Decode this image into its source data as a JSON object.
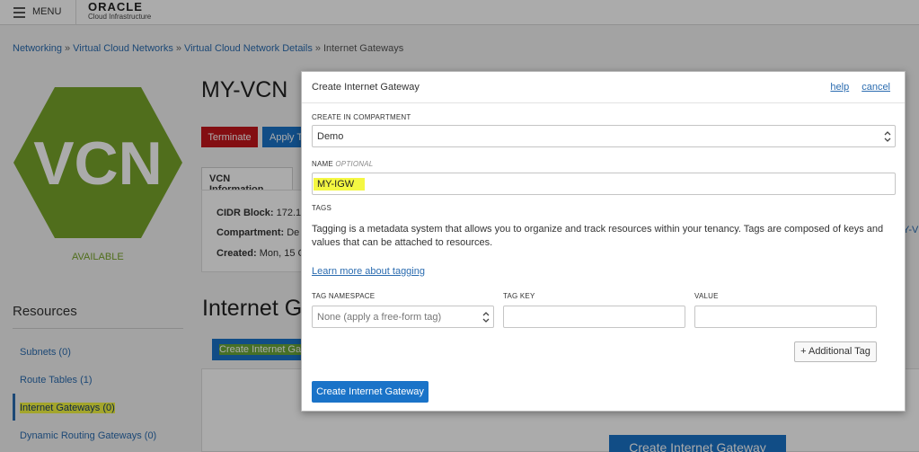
{
  "topbar": {
    "menu_label": "MENU",
    "logo_main": "ORACLE",
    "logo_sub": "Cloud Infrastructure"
  },
  "breadcrumb": {
    "items": [
      "Networking",
      "Virtual Cloud Networks",
      "Virtual Cloud Network Details"
    ],
    "separator": "»",
    "current": "Internet Gateways"
  },
  "vcn": {
    "badge_text": "VCN",
    "status": "AVAILABLE",
    "name": "MY-VCN",
    "terminate_label": "Terminate",
    "apply_label": "Apply T",
    "tab_label": "VCN Information",
    "info": [
      {
        "label": "CIDR Block:",
        "value": "172.1"
      },
      {
        "label": "Compartment:",
        "value": "De"
      },
      {
        "label": "Created:",
        "value": "Mon, 15 C"
      }
    ],
    "right_link_fragment": "Y-V"
  },
  "resources": {
    "title": "Resources",
    "items": [
      "Subnets (0)",
      "Route Tables (1)",
      "Internet Gateways (0)",
      "Dynamic Routing Gateways (0)"
    ]
  },
  "gateways_section": {
    "title": "Internet G",
    "create_button": "Create Internet Gat",
    "bottom_create_button": "Create Internet Gateway"
  },
  "modal": {
    "title": "Create Internet Gateway",
    "help_link": "help",
    "cancel_link": "cancel",
    "compartment_label": "CREATE IN COMPARTMENT",
    "compartment_value": "Demo",
    "name_label": "NAME",
    "name_optional": "OPTIONAL",
    "name_value": "MY-IGW",
    "tags_label": "TAGS",
    "tags_description": "Tagging is a metadata system that allows you to organize and track resources within your tenancy. Tags are composed of keys and values that can be attached to resources.",
    "learn_more": "Learn more about tagging",
    "tag_namespace_label": "TAG NAMESPACE",
    "tag_namespace_value": "None (apply a free-form tag)",
    "tag_key_label": "TAG KEY",
    "tag_key_value": "",
    "value_label": "VALUE",
    "value_value": "",
    "additional_tag": "+ Additional Tag",
    "submit": "Create Internet Gateway"
  },
  "colors": {
    "accent_blue": "#1a73c8",
    "danger_red": "#c3161c",
    "vcn_green": "#78a52a",
    "highlight_yellow": "#f4f742"
  }
}
